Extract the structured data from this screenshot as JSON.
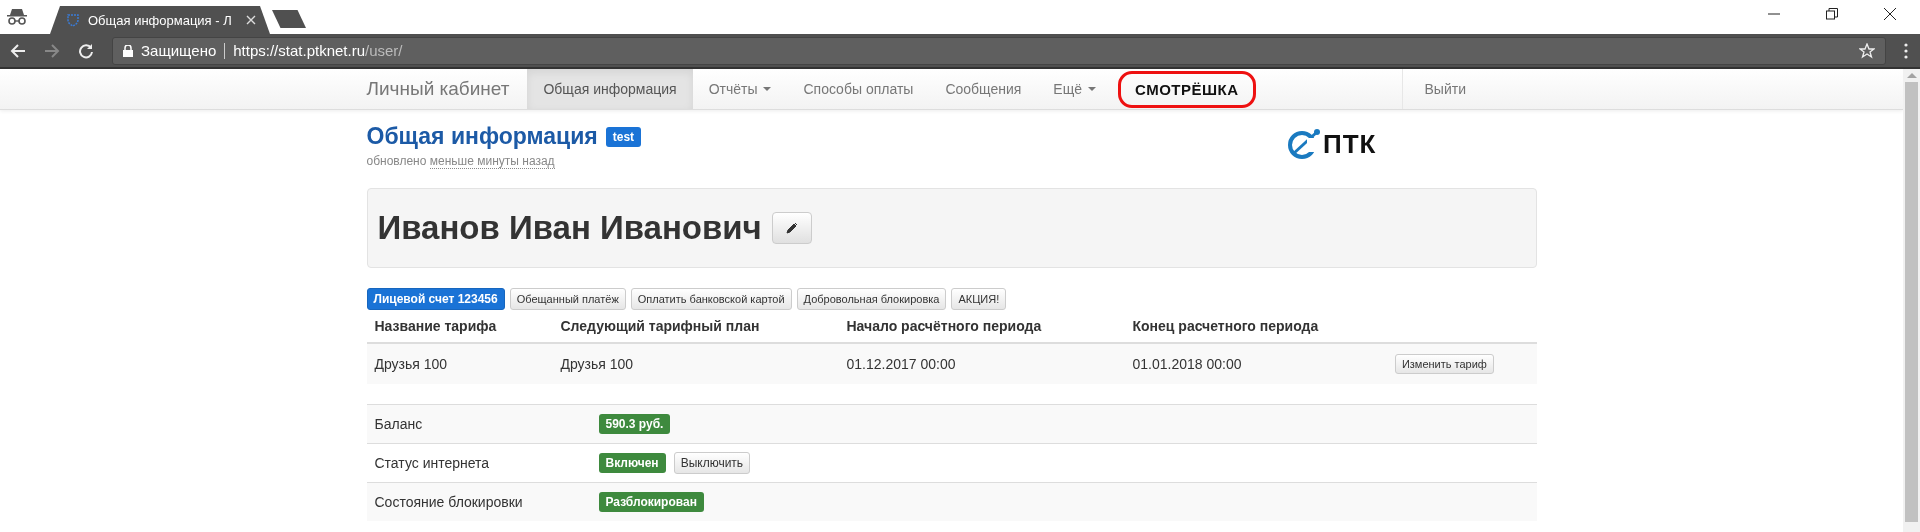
{
  "browser": {
    "tab_title": "Общая информация - Л",
    "security": "Защищено",
    "url_host": "https://stat.ptknet.ru",
    "url_path": "/user/"
  },
  "navbar": {
    "brand": "Личный кабинет",
    "items": [
      {
        "label": "Общая информация",
        "selected": true,
        "dropdown": false
      },
      {
        "label": "Отчёты",
        "selected": false,
        "dropdown": true
      },
      {
        "label": "Способы оплаты",
        "selected": false,
        "dropdown": false
      },
      {
        "label": "Сообщения",
        "selected": false,
        "dropdown": false
      },
      {
        "label": "Ещё",
        "selected": false,
        "dropdown": true
      }
    ],
    "logo_link": "СМОТРЁШКА",
    "logout": "Выйти"
  },
  "header": {
    "title": "Общая информация",
    "badge": "test",
    "updated_prefix": "обновлено",
    "updated_link": "меньше минуты назад",
    "logo": "ПТК"
  },
  "profile": {
    "name": "Иванов Иван Иванович"
  },
  "account_buttons": [
    {
      "label": "Лицевой счет 123456",
      "kind": "primary"
    },
    {
      "label": "Обещанный платёж",
      "kind": "default"
    },
    {
      "label": "Оплатить банковской картой",
      "kind": "default"
    },
    {
      "label": "Добровольная блокировка",
      "kind": "default"
    },
    {
      "label": "АКЦИЯ!",
      "kind": "default"
    }
  ],
  "tariff_table": {
    "columns": [
      "Название тарифа",
      "Следующий тарифный план",
      "Начало расчётного периода",
      "Конец расчетного периода"
    ],
    "rows": [
      {
        "cells": [
          "Друзья 100",
          "Друзья 100",
          "01.12.2017 00:00",
          "01.01.2018 00:00"
        ],
        "action": "Изменить тариф"
      }
    ]
  },
  "info": [
    {
      "label": "Баланс",
      "value": "590.3 руб."
    },
    {
      "label": "Статус интернета",
      "value": "Включен",
      "action": "Выключить"
    },
    {
      "label": "Состояние блокировки",
      "value": "Разблокирован"
    }
  ]
}
